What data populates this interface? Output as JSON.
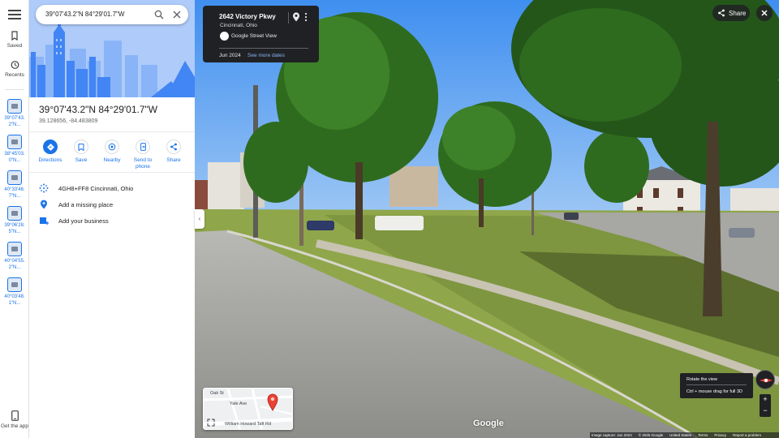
{
  "rail": {
    "saved_label": "Saved",
    "recents_label": "Recents",
    "recent_items": [
      {
        "label": "39°07'43.2\"N..."
      },
      {
        "label": "38°45'03.0\"N..."
      },
      {
        "label": "40°33'46.7\"N..."
      },
      {
        "label": "39°06'28.5\"N..."
      },
      {
        "label": "40°04'55.2\"N..."
      },
      {
        "label": "40°03'48.1\"N..."
      }
    ],
    "get_app_label": "Get the app"
  },
  "search": {
    "value": "39°07'43.2\"N 84°29'01.7\"W"
  },
  "place": {
    "title": "39°07'43.2\"N 84°29'01.7\"W",
    "decimal": "39.128656, -84.483809"
  },
  "actions": [
    {
      "label": "Directions"
    },
    {
      "label": "Save"
    },
    {
      "label": "Nearby"
    },
    {
      "label": "Send to phone"
    },
    {
      "label": "Share"
    }
  ],
  "details": {
    "plus_code": "4GH8+FF8 Cincinnati, Ohio",
    "add_place": "Add a missing place",
    "add_business": "Add your business"
  },
  "streetview": {
    "address": "2642 Victory Pkwy",
    "city": "Cincinnati, Ohio",
    "source": "Google Street View",
    "date": "Jun 2024",
    "more_dates": "See more dates",
    "share_label": "Share",
    "tooltip_title": "Rotate the view",
    "tooltip_hint": "Ctrl + mouse drag for full 3D",
    "zoom_in": "+",
    "zoom_out": "−",
    "logo": "Google"
  },
  "minimap": {
    "street_1": "Oak St",
    "street_2": "Yale Ave",
    "street_3": "William Howard Taft Rd"
  },
  "footer": {
    "capture": "Image capture: Jun 2024",
    "copyright": "© 2025 Google",
    "country": "United States",
    "terms": "Terms",
    "privacy": "Privacy",
    "report": "Report a problem"
  },
  "colors": {
    "accent": "#1a73e8",
    "dark_card": "#202124",
    "sky": "#5aa0e8",
    "grass": "#8fa64a"
  }
}
